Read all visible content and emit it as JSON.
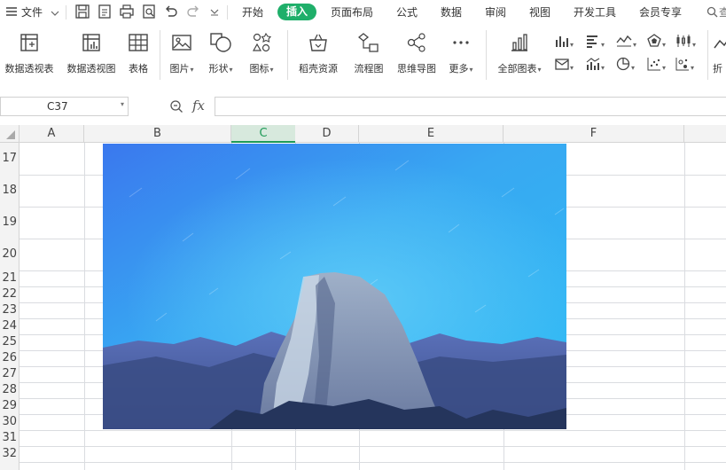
{
  "menu": {
    "file_label": "文件",
    "tabs": [
      "开始",
      "插入",
      "页面布局",
      "公式",
      "数据",
      "审阅",
      "视图",
      "开发工具",
      "会员专享"
    ],
    "active_tab": "插入",
    "search_partial": "查"
  },
  "ribbon": {
    "pivot_table": "数据透视表",
    "pivot_chart": "数据透视图",
    "table": "表格",
    "picture": "图片",
    "shape": "形状",
    "icon": "图标",
    "wps_resources": "稻壳资源",
    "flowchart": "流程图",
    "mindmap": "思维导图",
    "more": "更多",
    "all_charts": "全部图表",
    "line_partial": "折"
  },
  "formula_bar": {
    "name_box": "C37",
    "fx_label": "fx",
    "formula": ""
  },
  "grid": {
    "columns": [
      "A",
      "B",
      "C",
      "D",
      "E",
      "F"
    ],
    "selected_column": "C",
    "rows": [
      "17",
      "18",
      "19",
      "20",
      "21",
      "22",
      "23",
      "24",
      "25",
      "26",
      "27",
      "28",
      "29",
      "30",
      "31",
      "32"
    ]
  },
  "colors": {
    "accent": "#1faf6a",
    "selected_col": "#1e9a57"
  }
}
